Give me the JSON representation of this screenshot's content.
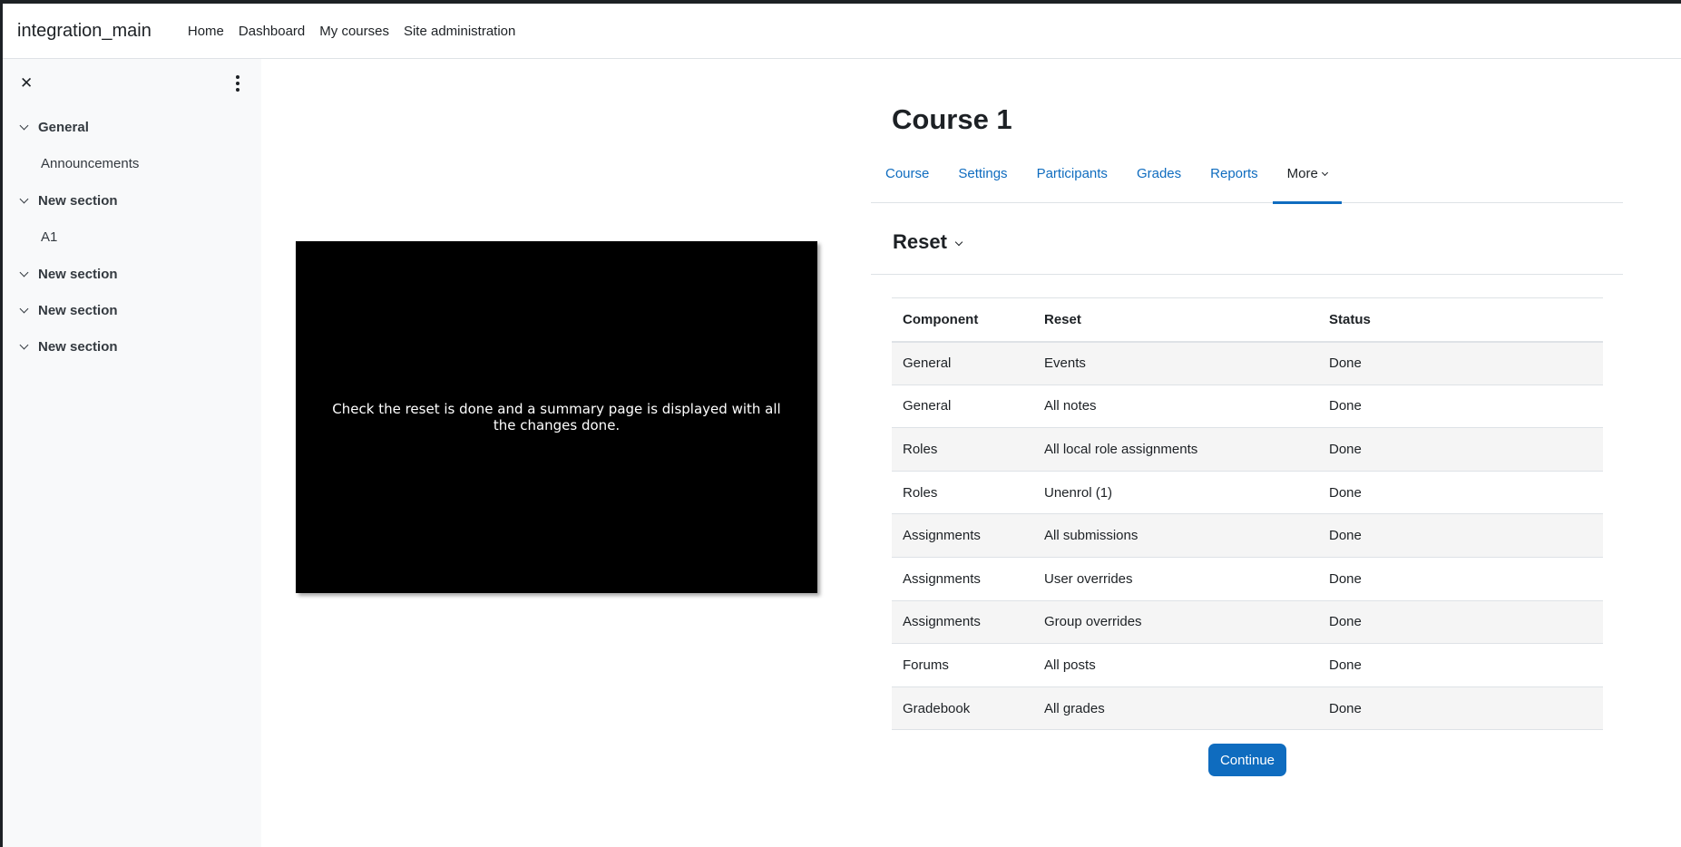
{
  "navbar": {
    "brand": "integration_main",
    "links": [
      "Home",
      "Dashboard",
      "My courses",
      "Site administration"
    ]
  },
  "drawer": {
    "close_icon": "close-icon",
    "menu_icon": "kebab-menu-icon",
    "sections": [
      {
        "title": "General",
        "items": [
          "Announcements"
        ]
      },
      {
        "title": "New section",
        "items": [
          "A1"
        ]
      },
      {
        "title": "New section",
        "items": []
      },
      {
        "title": "New section",
        "items": []
      },
      {
        "title": "New section",
        "items": []
      }
    ]
  },
  "video": {
    "caption": "Check the reset is done and a summary page is displayed with all the changes done."
  },
  "course": {
    "title": "Course 1",
    "tabs": [
      "Course",
      "Settings",
      "Participants",
      "Grades",
      "Reports",
      "More"
    ],
    "active_tab": "More"
  },
  "page": {
    "heading": "Reset"
  },
  "table": {
    "headers": [
      "Component",
      "Reset",
      "Status"
    ],
    "rows": [
      [
        "General",
        "Events",
        "Done"
      ],
      [
        "General",
        "All notes",
        "Done"
      ],
      [
        "Roles",
        "All local role assignments",
        "Done"
      ],
      [
        "Roles",
        "Unenrol (1)",
        "Done"
      ],
      [
        "Assignments",
        "All submissions",
        "Done"
      ],
      [
        "Assignments",
        "User overrides",
        "Done"
      ],
      [
        "Assignments",
        "Group overrides",
        "Done"
      ],
      [
        "Forums",
        "All posts",
        "Done"
      ],
      [
        "Gradebook",
        "All grades",
        "Done"
      ]
    ]
  },
  "actions": {
    "continue_label": "Continue"
  },
  "colors": {
    "primary": "#0f6cbf",
    "drawer_bg": "#f8f9fa",
    "text": "#1d2125"
  }
}
